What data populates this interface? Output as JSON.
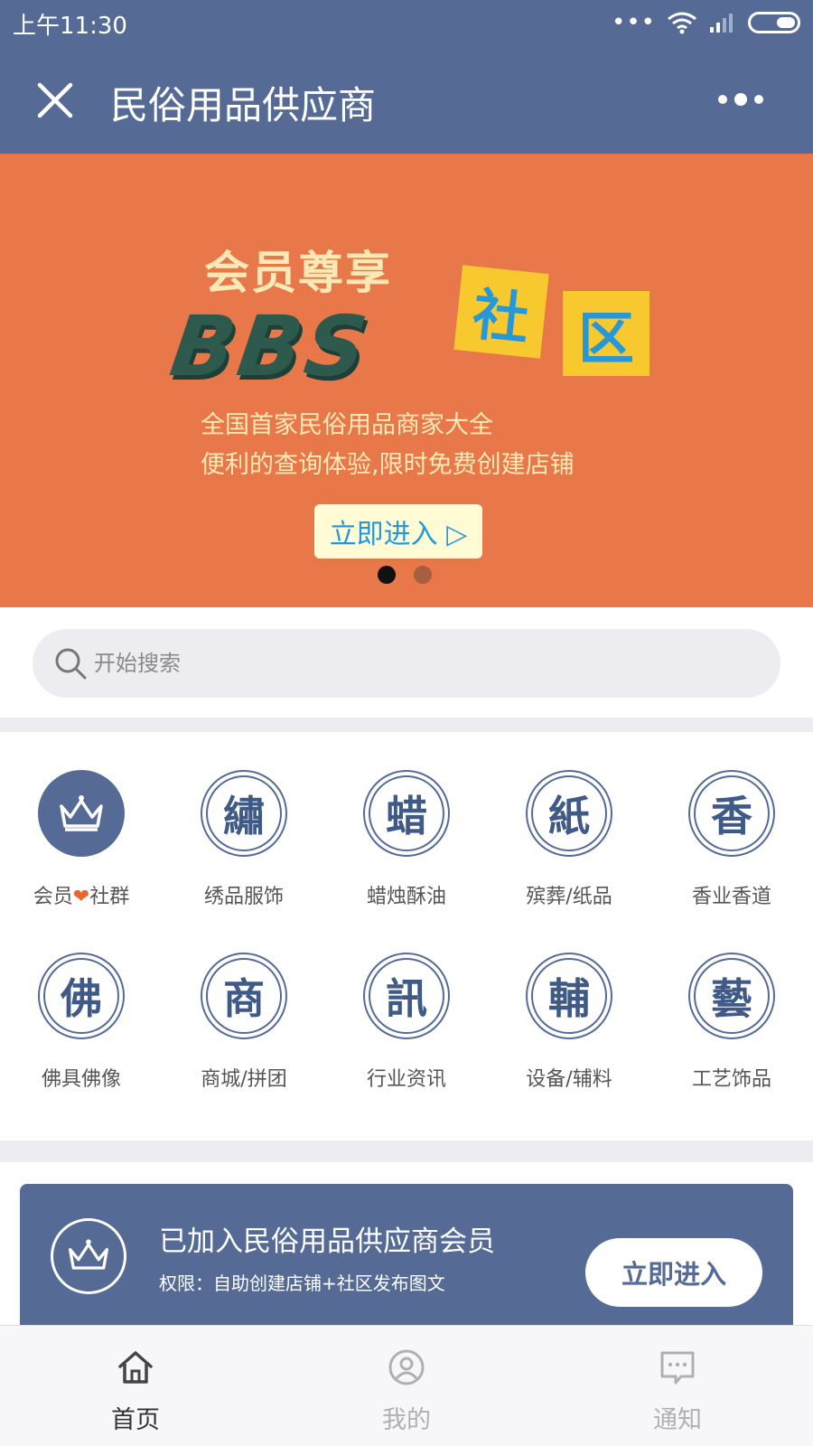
{
  "status_bar": {
    "time": "上午11:30"
  },
  "header": {
    "title": "民俗用品供应商"
  },
  "banner": {
    "kicker": "会员尊享",
    "logo": "BBS",
    "tiles": [
      "社",
      "区"
    ],
    "line1": "全国首家民俗用品商家大全",
    "line2": "便利的查询体验,限时免费创建店铺",
    "cta": "立即进入 ▷",
    "slides": 2,
    "active_slide": 1
  },
  "search": {
    "placeholder": "开始搜索"
  },
  "categories": [
    {
      "glyph": "",
      "label_pre": "会员",
      "label_heart": "❤",
      "label_post": "社群",
      "icon": "crown-icon"
    },
    {
      "glyph": "繡",
      "label": "绣品服饰"
    },
    {
      "glyph": "蜡",
      "label": "蜡烛酥油"
    },
    {
      "glyph": "紙",
      "label": "殡葬/纸品"
    },
    {
      "glyph": "香",
      "label": "香业香道"
    },
    {
      "glyph": "佛",
      "label": "佛具佛像"
    },
    {
      "glyph": "商",
      "label": "商城/拼团"
    },
    {
      "glyph": "訊",
      "label": "行业资讯"
    },
    {
      "glyph": "輔",
      "label": "设备/辅料"
    },
    {
      "glyph": "藝",
      "label": "工艺饰品"
    }
  ],
  "member": {
    "title": "已加入民俗用品供应商会员",
    "subtitle": "权限：自助创建店铺+社区发布图文",
    "cta": "立即进入"
  },
  "tabs": [
    {
      "label": "首页",
      "icon": "home-icon",
      "active": true
    },
    {
      "label": "我的",
      "icon": "user-icon",
      "active": false
    },
    {
      "label": "通知",
      "icon": "message-icon",
      "active": false
    }
  ],
  "colors": {
    "primary": "#556b96",
    "banner": "#e8784a",
    "accent": "#2698d9",
    "tile": "#f7c92e"
  }
}
